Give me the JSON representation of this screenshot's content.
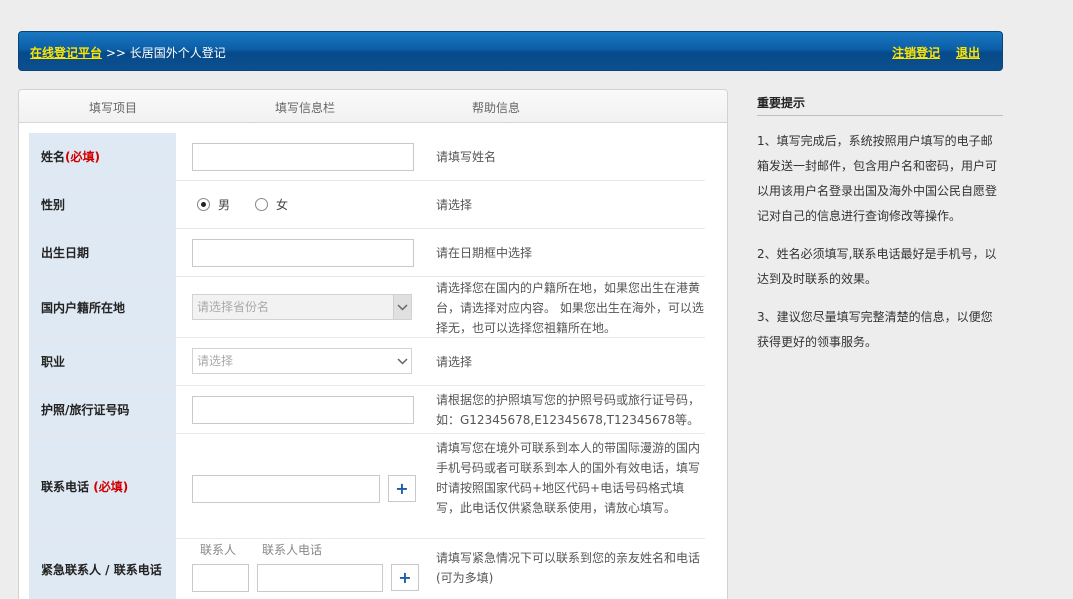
{
  "header": {
    "platform_link": "在线登记平台",
    "separator": ">>",
    "current_page": "长居国外个人登记",
    "logout_register": "注销登记",
    "exit": "退出"
  },
  "columns": {
    "item": "填写项目",
    "info": "填写信息栏",
    "help": "帮助信息"
  },
  "form": {
    "name": {
      "label": "姓名",
      "required": "(必填)",
      "help": "请填写姓名"
    },
    "gender": {
      "label": "性别",
      "male": "男",
      "female": "女",
      "selected": "男",
      "help": "请选择"
    },
    "birth": {
      "label": "出生日期",
      "help": "请在日期框中选择"
    },
    "domicile": {
      "label": "国内户籍所在地",
      "placeholder": "请选择省份名",
      "help": "请选择您在国内的户籍所在地，如果您出生在港黄台，请选择对应内容。 如果您出生在海外，可以选择无，也可以选择您祖籍所在地。"
    },
    "occupation": {
      "label": "职业",
      "placeholder": "请选择",
      "help": "请选择"
    },
    "passport": {
      "label": "护照/旅行证号码",
      "help": "请根据您的护照填写您的护照号码或旅行证号码，如：G12345678,E12345678,T12345678等。"
    },
    "phone": {
      "label": "联系电话",
      "required": "(必填)",
      "help": "请填写您在境外可联系到本人的带国际漫游的国内手机号码或者可联系到本人的国外有效电话，填写时请按照国家代码+地区代码+电话号码格式填写，此电话仅供紧急联系使用，请放心填写。"
    },
    "emergency": {
      "label": "紧急联系人 / 联系电话",
      "contact": "联系人",
      "contact_phone": "联系人电话",
      "help": "请填写紧急情况下可以联系到您的亲友姓名和电话(可为多填)"
    },
    "plus": "+"
  },
  "tips": {
    "title": "重要提示",
    "items": [
      "1、填写完成后，系统按照用户填写的电子邮箱发送一封邮件，包含用户名和密码，用户可以用该用户名登录出国及海外中国公民自愿登记对自己的信息进行查询修改等操作。",
      "2、姓名必须填写,联系电话最好是手机号，以达到及时联系的效果。",
      "3、建议您尽量填写完整清楚的信息，以便您获得更好的领事服务。"
    ]
  },
  "colors": {
    "header_blue": "#0c5ea8",
    "link_yellow": "#ffe400",
    "label_bg": "#dfe9f3",
    "required_red": "#d00000"
  }
}
